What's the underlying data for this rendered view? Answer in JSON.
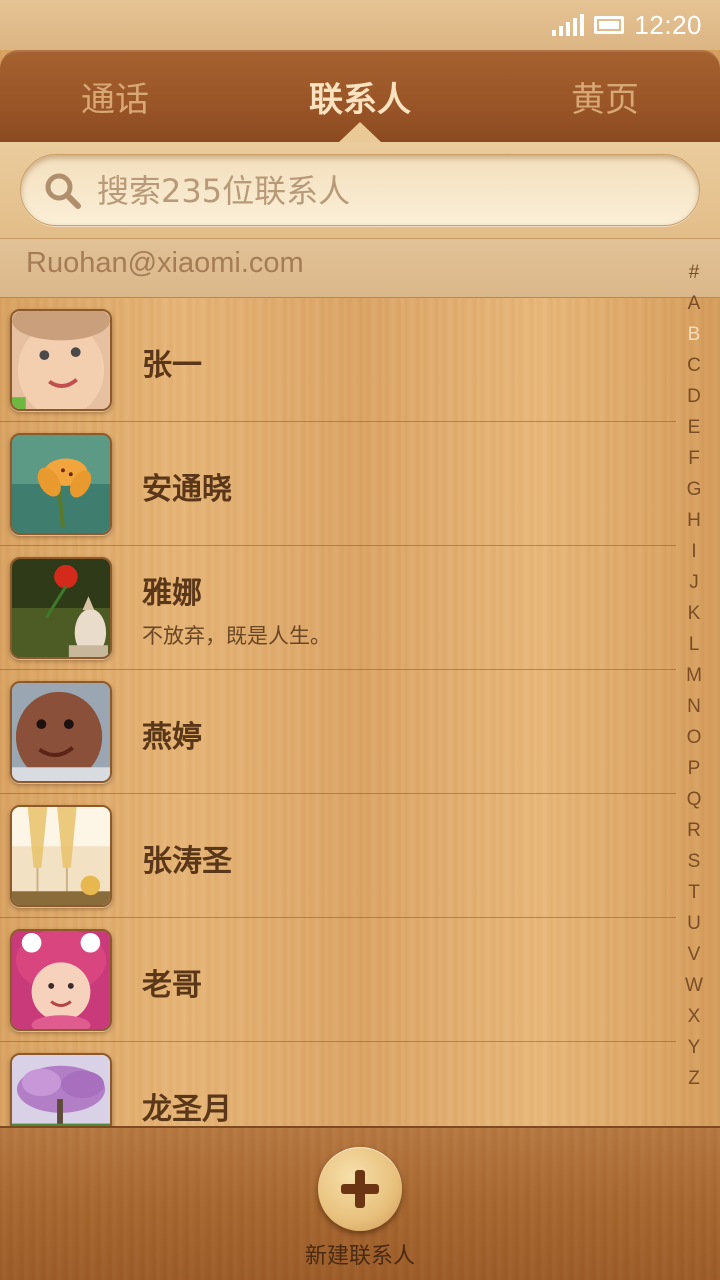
{
  "status_bar": {
    "time": "12:20",
    "signal_icon": "signal-icon",
    "battery_icon": "battery-icon"
  },
  "tabs": [
    {
      "label": "通话",
      "active": false
    },
    {
      "label": "联系人",
      "active": true
    },
    {
      "label": "黄页",
      "active": false
    }
  ],
  "search": {
    "placeholder": "搜索235位联系人",
    "icon": "search-icon"
  },
  "account": {
    "email": "Ruohan@xiaomi.com"
  },
  "contacts": [
    {
      "name": "张一",
      "status": ""
    },
    {
      "name": "安通晓",
      "status": ""
    },
    {
      "name": "雅娜",
      "status": "不放弃，既是人生。"
    },
    {
      "name": "燕婷",
      "status": ""
    },
    {
      "name": "张涛圣",
      "status": ""
    },
    {
      "name": "老哥",
      "status": ""
    },
    {
      "name": "龙圣月",
      "status": ""
    }
  ],
  "alphabet_index": [
    "#",
    "A",
    "B",
    "C",
    "D",
    "E",
    "F",
    "G",
    "H",
    "I",
    "J",
    "K",
    "L",
    "M",
    "N",
    "O",
    "P",
    "Q",
    "R",
    "S",
    "T",
    "U",
    "V",
    "W",
    "X",
    "Y",
    "Z"
  ],
  "alphabet_active": "B",
  "bottom_bar": {
    "add_label": "新建联系人",
    "add_icon": "plus-icon"
  },
  "colors": {
    "wood_light": "#e2b172",
    "wood_dark": "#9c5c28",
    "text_brown": "#5b3719",
    "active_tab": "#fbe3bf"
  }
}
